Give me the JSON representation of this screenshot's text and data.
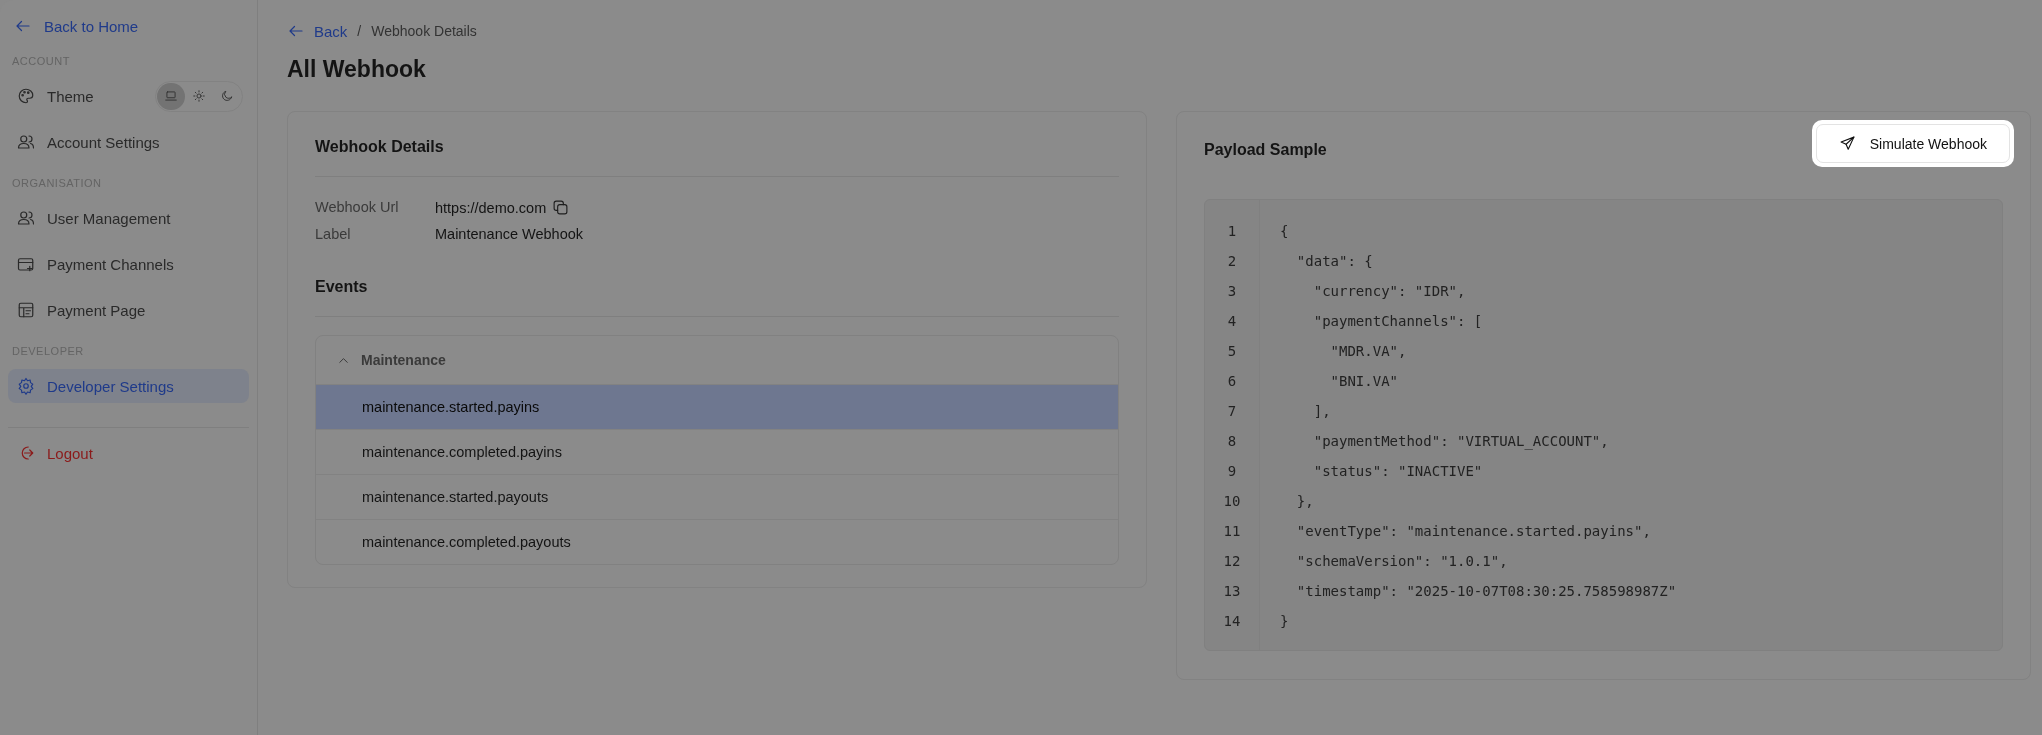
{
  "sidebar": {
    "back_link": "Back to Home",
    "sections": [
      {
        "heading": "ACCOUNT",
        "items": [
          {
            "kind": "theme",
            "label": "Theme",
            "selected": false,
            "theme_options": [
              {
                "kind": "system",
                "selected": true
              },
              {
                "kind": "light",
                "selected": false
              },
              {
                "kind": "dark",
                "selected": false
              }
            ]
          },
          {
            "kind": "account",
            "label": "Account Settings",
            "selected": false
          }
        ]
      },
      {
        "heading": "ORGANISATION",
        "items": [
          {
            "kind": "users",
            "label": "User Management",
            "selected": false
          },
          {
            "kind": "channels",
            "label": "Payment Channels",
            "selected": false
          },
          {
            "kind": "page",
            "label": "Payment Page",
            "selected": false
          }
        ]
      },
      {
        "heading": "DEVELOPER",
        "items": [
          {
            "kind": "developer",
            "label": "Developer Settings",
            "selected": true
          }
        ]
      }
    ],
    "logout": "Logout"
  },
  "breadcrumb": {
    "back": "Back",
    "separator": "/",
    "current": "Webhook Details"
  },
  "page_title": "All Webhook",
  "details_card": {
    "title": "Webhook Details",
    "fields": [
      {
        "label": "Webhook Url",
        "value": "https://demo.com",
        "copyable": true
      },
      {
        "label": "Label",
        "value": "Maintenance Webhook",
        "copyable": false
      }
    ],
    "events_title": "Events",
    "event_groups": [
      {
        "name": "Maintenance",
        "expanded": true,
        "events": [
          {
            "name": "maintenance.started.payins",
            "selected": true
          },
          {
            "name": "maintenance.completed.payins",
            "selected": false
          },
          {
            "name": "maintenance.started.payouts",
            "selected": false
          },
          {
            "name": "maintenance.completed.payouts",
            "selected": false
          }
        ]
      }
    ]
  },
  "payload_card": {
    "title": "Payload Sample",
    "simulate_button": "Simulate Webhook",
    "code": {
      "line_numbers": [
        "1",
        "2",
        "3",
        "4",
        "5",
        "6",
        "7",
        "8",
        "9",
        "10",
        "11",
        "12",
        "13",
        "14"
      ],
      "lines": [
        "{",
        "  \"data\": {",
        "    \"currency\": \"IDR\",",
        "    \"paymentChannels\": [",
        "      \"MDR.VA\",",
        "      \"BNI.VA\"",
        "    ],",
        "    \"paymentMethod\": \"VIRTUAL_ACCOUNT\",",
        "    \"status\": \"INACTIVE\"",
        "  },",
        "  \"eventType\": \"maintenance.started.payins\",",
        "  \"schemaVersion\": \"1.0.1\",",
        "  \"timestamp\": \"2025-10-07T08:30:25.758598987Z\"",
        "}"
      ]
    }
  }
}
